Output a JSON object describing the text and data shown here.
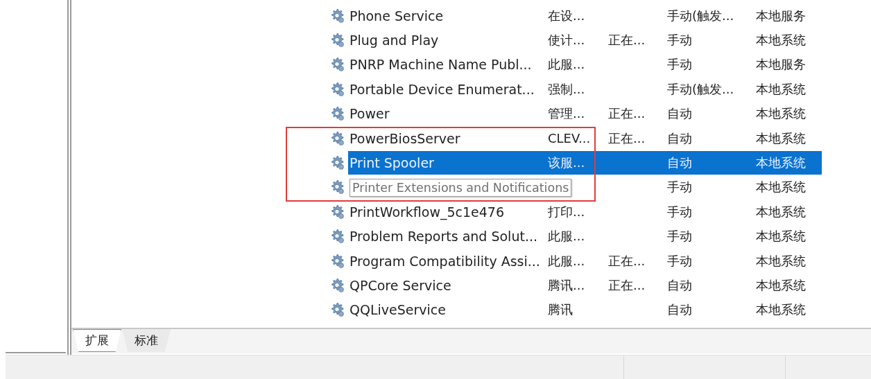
{
  "services": [
    {
      "name": "Phone Service",
      "description": "在设...",
      "startup": "手动(触发...",
      "logon": "本地服务",
      "selected": false,
      "tooltip": false
    },
    {
      "name": "Plug and Play",
      "description": "使计...",
      "status": "正在...",
      "startup": "手动",
      "logon": "本地系统",
      "selected": false,
      "tooltip": false
    },
    {
      "name": "PNRP Machine Name Publ...",
      "description": "此服...",
      "startup": "手动",
      "logon": "本地服务",
      "selected": false,
      "tooltip": false
    },
    {
      "name": "Portable Device Enumerat...",
      "description": "强制...",
      "startup": "手动(触发...",
      "logon": "本地系统",
      "selected": false,
      "tooltip": false
    },
    {
      "name": "Power",
      "description": "管理...",
      "status": "正在...",
      "startup": "自动",
      "logon": "本地系统",
      "selected": false,
      "tooltip": false
    },
    {
      "name": "PowerBiosServer",
      "description": "CLEV...",
      "status": "正在...",
      "startup": "自动",
      "logon": "本地系统",
      "selected": false,
      "tooltip": false
    },
    {
      "name": "Print Spooler",
      "description": "该服...",
      "startup": "自动",
      "logon": "本地系统",
      "selected": true,
      "tooltip": false
    },
    {
      "name": "Printer Extensions and Notifications",
      "startup": "手动",
      "logon": "本地系统",
      "selected": false,
      "tooltip": true
    },
    {
      "name": "PrintWorkflow_5c1e476",
      "description": "打印...",
      "startup": "手动",
      "logon": "本地系统",
      "selected": false,
      "tooltip": false
    },
    {
      "name": "Problem Reports and Solut...",
      "description": "此服...",
      "startup": "手动",
      "logon": "本地系统",
      "selected": false,
      "tooltip": false
    },
    {
      "name": "Program Compatibility Assi...",
      "description": "此服...",
      "status": "正在...",
      "startup": "手动",
      "logon": "本地系统",
      "selected": false,
      "tooltip": false
    },
    {
      "name": "QPCore Service",
      "description": "腾讯...",
      "status": "正在...",
      "startup": "自动",
      "logon": "本地系统",
      "selected": false,
      "tooltip": false
    },
    {
      "name": "QQLiveService",
      "description": "腾讯",
      "startup": "自动",
      "logon": "本地系统",
      "selected": false,
      "tooltip": false
    }
  ],
  "tabs": [
    {
      "label": "扩展",
      "selected": true
    },
    {
      "label": "标准",
      "selected": false
    }
  ],
  "annotation": {
    "shown": true
  }
}
